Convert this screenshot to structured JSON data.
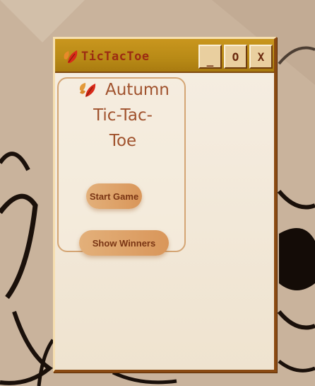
{
  "window": {
    "title": "TicTacToe",
    "controls": {
      "minimize": "_",
      "maximize": "O",
      "close": "X"
    }
  },
  "menu": {
    "heading_line1": "Autumn",
    "heading_line2": "Tic-Tac-",
    "heading_line3": "Toe",
    "start_button": "Start Game",
    "winners_button": "Show Winners"
  },
  "icons": {
    "title": "autumn-leaf-icon",
    "heading": "autumn-leaf-icon"
  },
  "colors": {
    "titlebar": "#b88a16",
    "title_text": "#9c2c12",
    "heading_text": "#a0522d",
    "button_bg": "#d9965a",
    "button_text": "#7a3514",
    "panel_border": "#d4a574"
  }
}
